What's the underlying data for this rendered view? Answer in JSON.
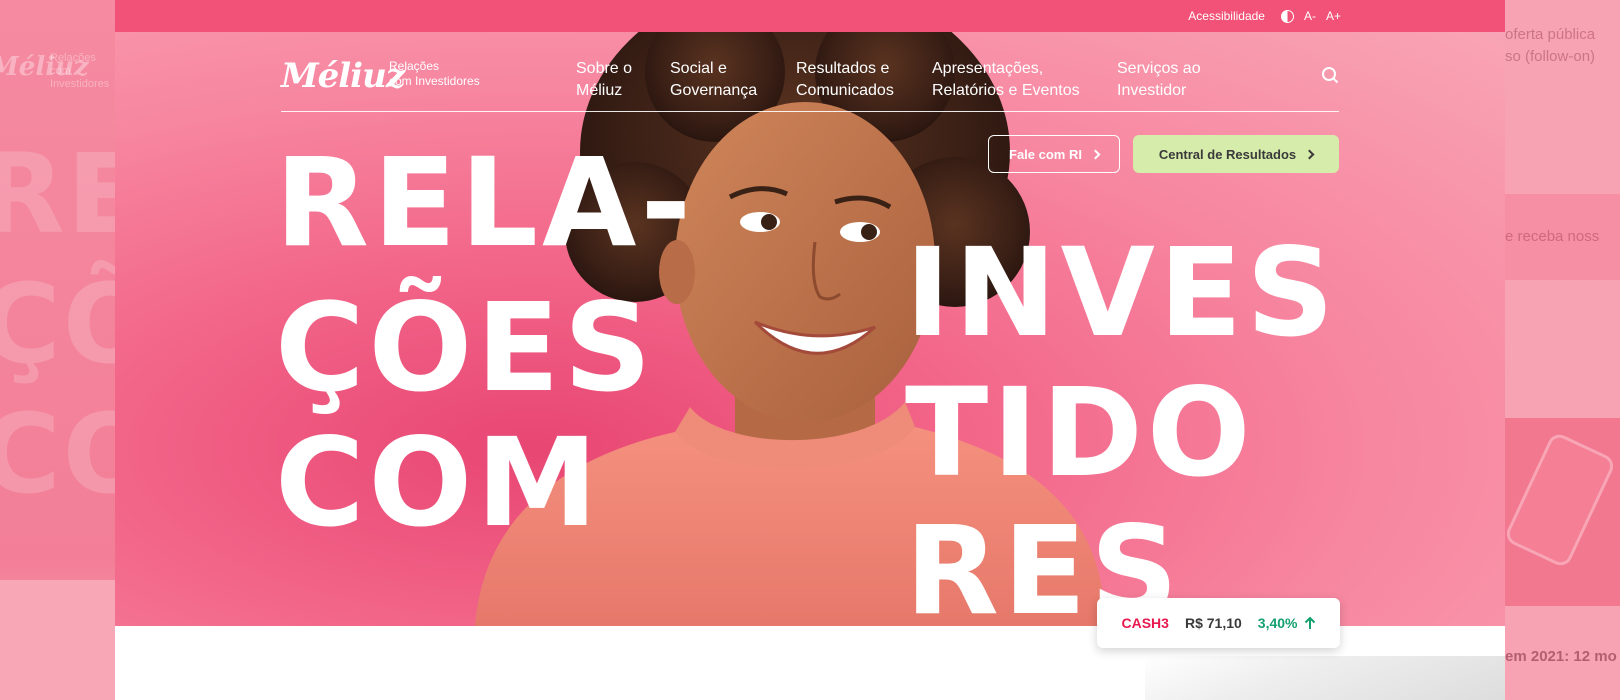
{
  "background_left": {
    "logo": "Méliuz",
    "sub": "Relações com Investidores",
    "words": [
      "RE",
      "ÇÕ",
      "CO"
    ]
  },
  "background_right": {
    "snippets": [
      "oferta pública",
      "so (follow-on)"
    ],
    "band": "e receba noss",
    "bold": "em 2021: 12 mo"
  },
  "topbar": {
    "accessibility_label": "Acessibilidade",
    "font_decrease": "A-",
    "font_increase": "A+"
  },
  "header": {
    "logo": "Méliuz",
    "logo_sub_line1": "Relações",
    "logo_sub_line2": "com Investidores",
    "nav": [
      {
        "line1": "Sobre o",
        "line2": "Méliuz"
      },
      {
        "line1": "Social e",
        "line2": "Governança"
      },
      {
        "line1": "Resultados e",
        "line2": "Comunicados"
      },
      {
        "line1": "Apresentações,",
        "line2": "Relatórios e Eventos"
      },
      {
        "line1": "Serviços ao",
        "line2": "Investidor"
      }
    ]
  },
  "hero": {
    "btn_ri": "Fale com RI",
    "btn_results": "Central de Resultados",
    "words_left": [
      "RELA-",
      "ÇÕES",
      "COM"
    ],
    "words_right": [
      "INVES",
      "TIDO",
      "RES"
    ]
  },
  "ticker": {
    "symbol": "CASH3",
    "price": "R$ 71,10",
    "change": "3,40%"
  },
  "colors": {
    "topbar": "#f25277",
    "accent_green": "#d6ecaa",
    "ticker_symbol": "#e8194f",
    "ticker_up": "#14a06f"
  }
}
